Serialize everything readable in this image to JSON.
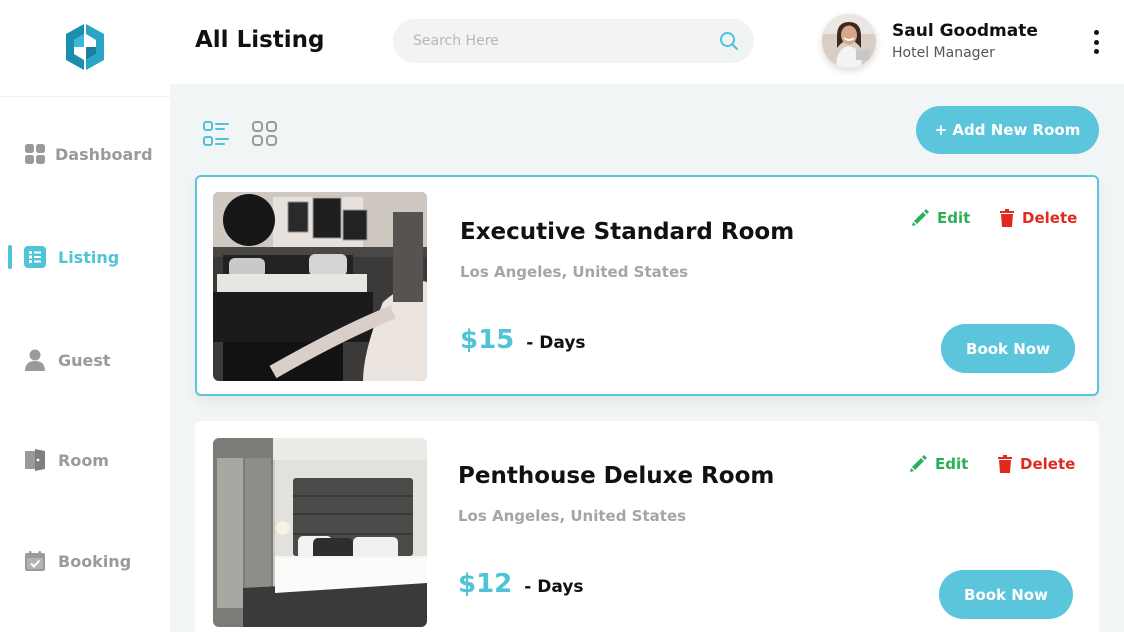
{
  "app": {
    "logo_icon": "ea-logo-icon",
    "accent": "#5bc5dc"
  },
  "sidebar": {
    "items": [
      {
        "label": "Dashboard",
        "icon": "dashboard-icon",
        "active": false
      },
      {
        "label": "Listing",
        "icon": "listing-icon",
        "active": true
      },
      {
        "label": "Guest",
        "icon": "user-icon",
        "active": false
      },
      {
        "label": "Room",
        "icon": "door-icon",
        "active": false
      },
      {
        "label": "Booking",
        "icon": "calendar-icon",
        "active": false
      }
    ]
  },
  "header": {
    "title": "All Listing",
    "search_placeholder": "Search Here",
    "search_icon": "search-icon",
    "user": {
      "name": "Saul Goodmate",
      "role": "Hotel Manager"
    },
    "menu_icon": "more-vertical-icon"
  },
  "toolbar": {
    "list_view_icon": "list-view-icon",
    "grid_view_icon": "grid-view-icon",
    "add_label": "+ Add New Room"
  },
  "rooms": [
    {
      "title": "Executive Standard Room",
      "location": "Los Angeles, United States",
      "price": "$15",
      "per": "- Days",
      "edit_label": "Edit",
      "delete_label": "Delete",
      "book_label": "Book Now",
      "selected": true
    },
    {
      "title": "Penthouse Deluxe Room",
      "location": "Los Angeles, United States",
      "price": "$12",
      "per": "- Days",
      "edit_label": "Edit",
      "delete_label": "Delete",
      "book_label": "Book Now",
      "selected": false
    }
  ],
  "colors": {
    "edit": "#2bb05a",
    "delete": "#e02a1f",
    "muted": "#9a9a9a"
  }
}
